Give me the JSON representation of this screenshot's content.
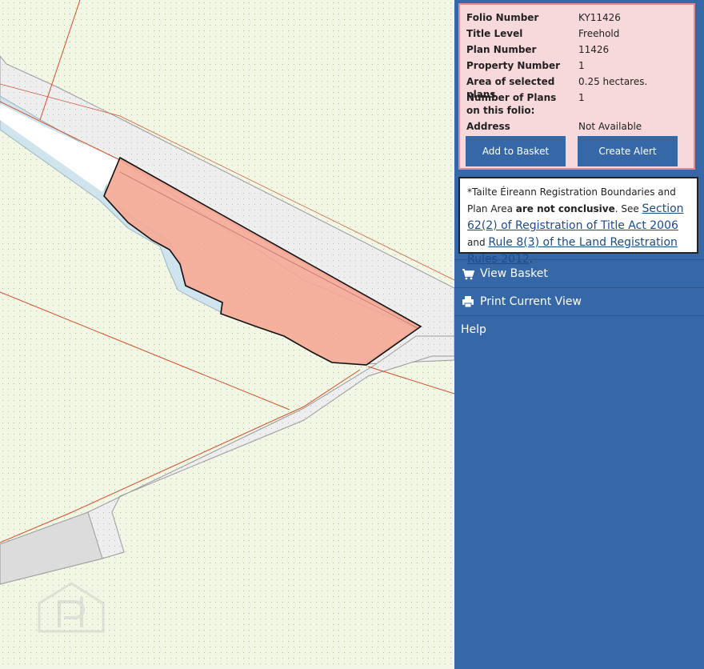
{
  "property": {
    "rows": [
      {
        "label": "Folio Number",
        "value": "KY11426"
      },
      {
        "label": "Title Level",
        "value": "Freehold"
      },
      {
        "label": "Plan Number",
        "value": "11426"
      },
      {
        "label": "Property Number",
        "value": "1"
      },
      {
        "label": "Area of selected plans",
        "value": "0.25 hectares."
      },
      {
        "label": "Number of Plans on this folio:",
        "value": "1"
      },
      {
        "label": "Address",
        "value": "Not Available"
      }
    ],
    "add_to_basket_label": "Add to Basket",
    "create_alert_label": "Create Alert"
  },
  "disclaimer": {
    "intro": "*Tailte Éireann Registration Boundaries and Plan Area ",
    "bold": "are not conclusive",
    "mid": ". See ",
    "link1": "Section 62(2) of Registration of Title Act 2006",
    "and": " and ",
    "link2": "Rule 8(3) of the Land Registration Rules 2012",
    "end": "."
  },
  "nav": {
    "view_basket": "View Basket",
    "view_basket_icon": "cart-icon",
    "print_current_view": "Print Current View",
    "print_icon": "printer-icon",
    "help": "Help"
  },
  "colors": {
    "panel": "#3668a8",
    "info_bg": "#f7d9db",
    "info_border": "#e48892",
    "parcel_fill": "#f5a996",
    "map_bg": "#f3f6e6"
  }
}
